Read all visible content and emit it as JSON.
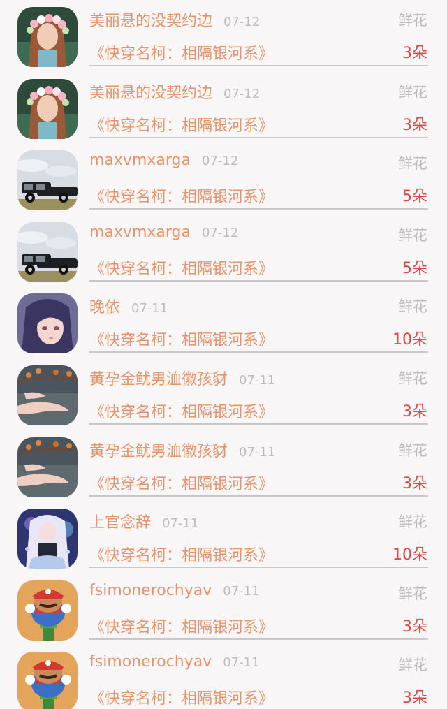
{
  "rows": [
    {
      "name": "美丽悬的没契约边",
      "date": "07-12",
      "gift": "鲜花",
      "book": "《快穿名柯：相隔银河系》",
      "count": "3朵",
      "avatar": "flower-crown-girl-avatar"
    },
    {
      "name": "美丽悬的没契约边",
      "date": "07-12",
      "gift": "鲜花",
      "book": "《快穿名柯：相隔银河系》",
      "count": "3朵",
      "avatar": "flower-crown-girl-avatar"
    },
    {
      "name": "maxvmxarga",
      "date": "07-12",
      "gift": "鲜花",
      "book": "《快穿名柯：相隔银河系》",
      "count": "5朵",
      "avatar": "vintage-car-avatar"
    },
    {
      "name": "maxvmxarga",
      "date": "07-12",
      "gift": "鲜花",
      "book": "《快穿名柯：相隔银河系》",
      "count": "5朵",
      "avatar": "vintage-car-avatar"
    },
    {
      "name": "晚依",
      "date": "07-11",
      "gift": "鲜花",
      "book": "《快穿名柯：相隔银河系》",
      "count": "10朵",
      "avatar": "anime-girl-avatar"
    },
    {
      "name": "黄孕金鱿男洫徽孩豺",
      "date": "07-11",
      "gift": "鲜花",
      "book": "《快穿名柯：相隔银河系》",
      "count": "3朵",
      "avatar": "hand-branch-avatar"
    },
    {
      "name": "黄孕金鱿男洫徽孩豺",
      "date": "07-11",
      "gift": "鲜花",
      "book": "《快穿名柯：相隔银河系》",
      "count": "3朵",
      "avatar": "hand-branch-avatar"
    },
    {
      "name": "上官念辞",
      "date": "07-11",
      "gift": "鲜花",
      "book": "《快穿名柯：相隔银河系》",
      "count": "10朵",
      "avatar": "fantasy-girl-avatar"
    },
    {
      "name": "fsimonerochyav",
      "date": "07-11",
      "gift": "鲜花",
      "book": "《快穿名柯：相隔银河系》",
      "count": "3朵",
      "avatar": "cartoon-plumber-avatar"
    },
    {
      "name": "fsimonerochyav",
      "date": "07-11",
      "gift": "鲜花",
      "book": "《快穿名柯：相隔银河系》",
      "count": "3朵",
      "avatar": "cartoon-plumber-avatar"
    }
  ],
  "colors": {
    "name": "#e8946a",
    "date": "#bdbdbd",
    "gift": "#bdbdbd",
    "count": "#e04848",
    "divider": "#c9c9c9",
    "background": "#f8f6f7"
  }
}
